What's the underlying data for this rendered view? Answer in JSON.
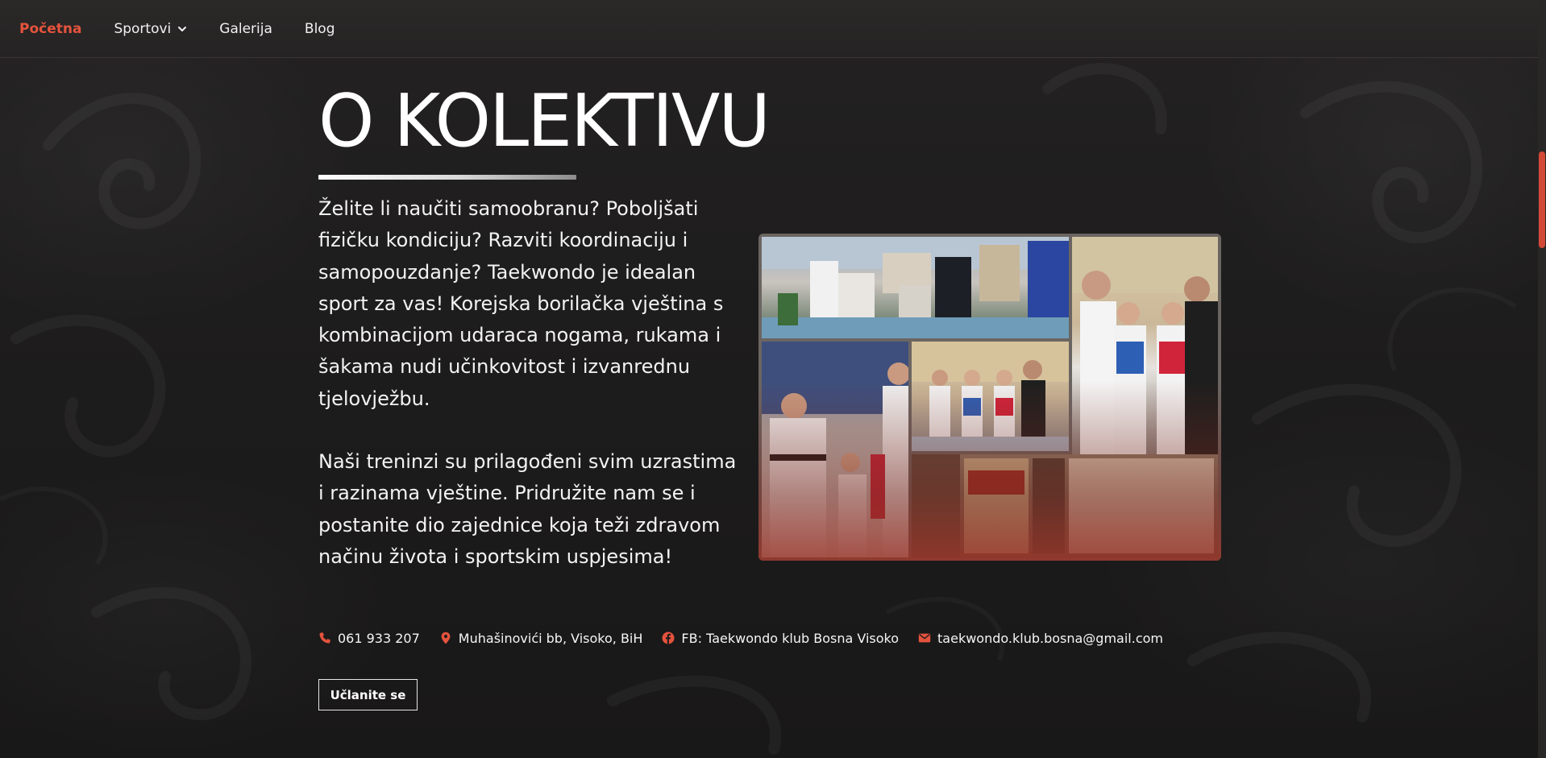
{
  "nav": {
    "items": [
      {
        "label": "Početna",
        "active": true
      },
      {
        "label": "Sportovi",
        "has_dropdown": true
      },
      {
        "label": "Galerija"
      },
      {
        "label": "Blog"
      }
    ]
  },
  "about": {
    "title": "O KOLEKTIVU",
    "paragraph1": "Želite li naučiti samoobranu? Poboljšati fizičku kondiciju? Razviti koordinaciju i samopouzdanje? Taekwondo je idealan sport za vas! Korejska borilačka vještina s kombinacijom udaraca nogama, rukama i šakama nudi učinkovitost i izvanrednu tjelovježbu.",
    "paragraph2": "Naši treninzi su prilagođeni svim uzrastima i razinama vještine. Pridružite nam se i postanite dio zajednice koja teži zdravom načinu života i sportskim uspjesima!"
  },
  "contacts": {
    "phone": "061 933 207",
    "address": "Muhašinovići bb, Visoko, BiH",
    "facebook": "FB: Taekwondo klub Bosna Visoko",
    "email": "taekwondo.klub.bosna@gmail.com"
  },
  "cta": {
    "label": "Učlanite se"
  },
  "colors": {
    "accent": "#e5533d",
    "background": "#1c1b1b",
    "text": "#ffffff"
  },
  "icons": {
    "phone": "phone-icon",
    "address": "map-pin-icon",
    "facebook": "facebook-icon",
    "email": "envelope-icon",
    "dropdown": "chevron-down-icon"
  }
}
